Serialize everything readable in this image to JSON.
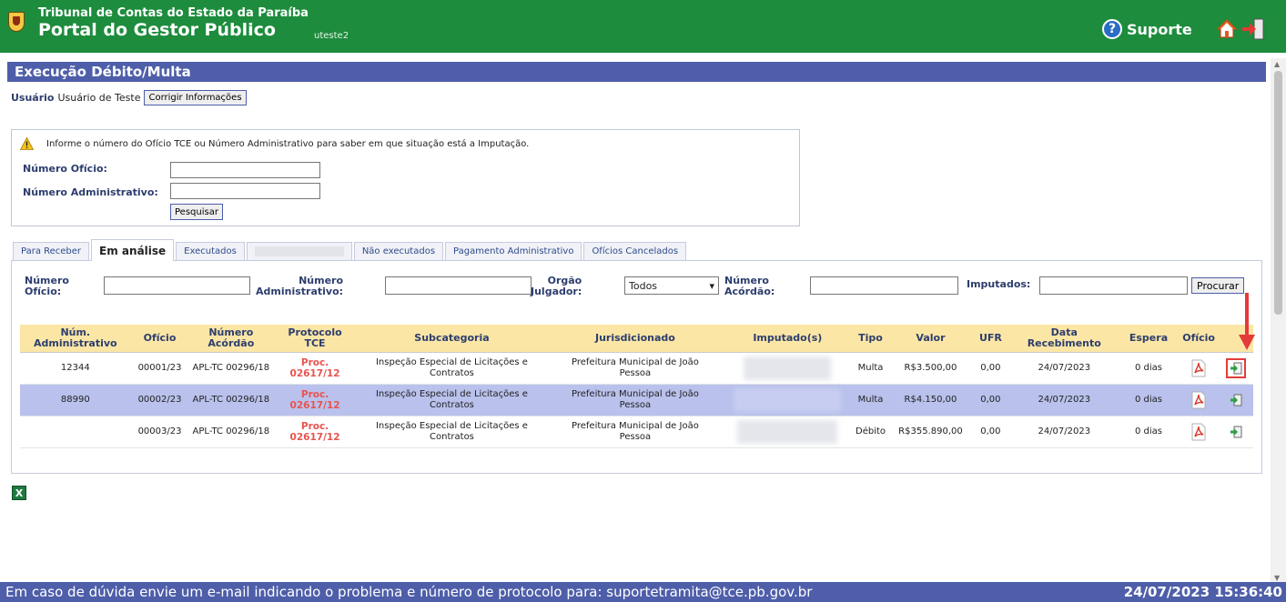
{
  "header": {
    "org_name": "Tribunal de Contas do Estado da Paraíba",
    "portal_name": "Portal do Gestor Público",
    "login": "uteste2",
    "support_label": "Suporte"
  },
  "page": {
    "title": "Execução Débito/Multa",
    "user_label": "Usuário",
    "user_name": "Usuário de Teste",
    "fix_info_button": "Corrigir Informações"
  },
  "search": {
    "info_text": "Informe o número do Ofício TCE ou Número Administrativo para saber em que situação está a Imputação.",
    "oficio_label": "Número Ofício:",
    "oficio_value": "",
    "admin_label": "Número Administrativo:",
    "admin_value": "",
    "button": "Pesquisar"
  },
  "tabs": [
    "Para Receber",
    "Em análise",
    "Executados",
    "",
    "Não executados",
    "Pagamento Administrativo",
    "Ofícios Cancelados"
  ],
  "active_tab": "Em análise",
  "filters": {
    "oficio_label_1": "Número",
    "oficio_label_2": "Ofício:",
    "admin_label_1": "Número",
    "admin_label_2": "Administrativo:",
    "orgao_label_1": "Orgão",
    "orgao_label_2": "Julgador:",
    "orgao_selected": "Todos",
    "acordao_label_1": "Número",
    "acordao_label_2": "Acórdão:",
    "imputados_label": "Imputados:",
    "button": "Procurar"
  },
  "table": {
    "headers": {
      "num_admin_1": "Núm.",
      "num_admin_2": "Administrativo",
      "oficio": "Ofício",
      "acordao_1": "Número",
      "acordao_2": "Acórdão",
      "protocolo_1": "Protocolo",
      "protocolo_2": "TCE",
      "subcategoria": "Subcategoria",
      "jurisdicionado": "Jurisdicionado",
      "imputados": "Imputado(s)",
      "tipo": "Tipo",
      "valor": "Valor",
      "ufr": "UFR",
      "data_1": "Data",
      "data_2": "Recebimento",
      "espera": "Espera",
      "oficio_doc": "Ofício"
    },
    "rows": [
      {
        "num_admin": "12344",
        "oficio": "00001/23",
        "acordao": "APL-TC 00296/18",
        "proc_1": "Proc.",
        "proc_2": "02617/12",
        "subcategoria_1": "Inspeção Especial de Licitações e",
        "subcategoria_2": "Contratos",
        "jurisdicionado_1": "Prefeitura Municipal de João",
        "jurisdicionado_2": "Pessoa",
        "tipo": "Multa",
        "valor": "R$3.500,00",
        "ufr": "0,00",
        "data": "24/07/2023",
        "espera": "0 dias"
      },
      {
        "num_admin": "88990",
        "oficio": "00002/23",
        "acordao": "APL-TC 00296/18",
        "proc_1": "Proc.",
        "proc_2": "02617/12",
        "subcategoria_1": "Inspeção Especial de Licitações e",
        "subcategoria_2": "Contratos",
        "jurisdicionado_1": "Prefeitura Municipal de João",
        "jurisdicionado_2": "Pessoa",
        "tipo": "Multa",
        "valor": "R$4.150,00",
        "ufr": "0,00",
        "data": "24/07/2023",
        "espera": "0 dias"
      },
      {
        "num_admin": "",
        "oficio": "00003/23",
        "acordao": "APL-TC 00296/18",
        "proc_1": "Proc.",
        "proc_2": "02617/12",
        "subcategoria_1": "Inspeção Especial de Licitações e",
        "subcategoria_2": "Contratos",
        "jurisdicionado_1": "Prefeitura Municipal de João",
        "jurisdicionado_2": "Pessoa",
        "tipo": "Débito",
        "valor": "R$355.890,00",
        "ufr": "0,00",
        "data": "24/07/2023",
        "espera": "0 dias"
      }
    ]
  },
  "icons": {
    "support": "question-circle-icon",
    "home": "home-icon",
    "logout": "logout-icon",
    "warning": "warning-icon",
    "pdf": "pdf-icon",
    "open": "open-arrow-icon",
    "excel": "excel-icon",
    "excel_glyph": "X",
    "annotation": "red-arrow-icon"
  },
  "colors": {
    "header_green": "#1d8c3d",
    "title_bar": "#4e5ea9",
    "table_header": "#fbe6a6",
    "row_highlight": "#b9c1ec",
    "proc_red": "#e9534f",
    "annotation_red": "#e53a3a"
  },
  "footer": {
    "text": "Em caso de dúvida envie um e-mail indicando o problema e número de protocolo para: suportetramita@tce.pb.gov.br",
    "datetime": "24/07/2023 15:36:40"
  }
}
